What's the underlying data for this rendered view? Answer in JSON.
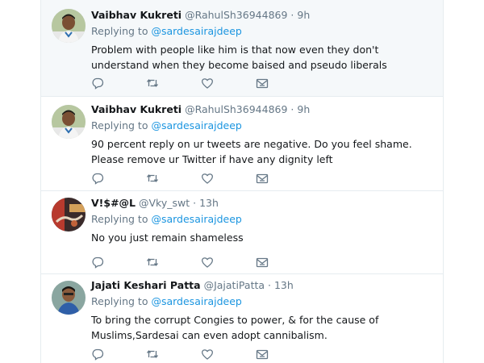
{
  "tweets": [
    {
      "name": "Vaibhav Kukreti",
      "handle": "@RahulSh36944869",
      "separator": "·",
      "time": "9h",
      "replying_label": "Replying to",
      "replying_to": "@sardesairajdeep",
      "text": "Problem with people like him is that now even they don't understand when they become baised and pseudo liberals",
      "icons": [
        "reply-icon",
        "retweet-icon",
        "like-icon",
        "message-icon"
      ]
    },
    {
      "name": "Vaibhav Kukreti",
      "handle": "@RahulSh36944869",
      "separator": "·",
      "time": "9h",
      "replying_label": "Replying to",
      "replying_to": "@sardesairajdeep",
      "text": "90 percent reply on ur tweets are negative. Do you feel shame. Please remove ur Twitter if have any dignity left",
      "icons": [
        "reply-icon",
        "retweet-icon",
        "like-icon",
        "message-icon"
      ]
    },
    {
      "name": "V!$#@L",
      "handle": "@Vky_swt",
      "separator": "·",
      "time": "13h",
      "replying_label": "Replying to",
      "replying_to": "@sardesairajdeep",
      "text": "No you just remain shameless",
      "icons": [
        "reply-icon",
        "retweet-icon",
        "like-icon",
        "message-icon"
      ]
    },
    {
      "name": "Jajati Keshari Patta",
      "handle": "@JajatiPatta",
      "separator": "·",
      "time": "13h",
      "replying_label": "Replying to",
      "replying_to": "@sardesairajdeep",
      "text": "To bring the corrupt Congies to power, & for the cause of Muslims,Sardesai can even adopt cannibalism.",
      "icons": [
        "reply-icon",
        "retweet-icon",
        "like-icon",
        "message-icon"
      ]
    }
  ],
  "colors": {
    "link": "#1b95e0",
    "muted": "#657786",
    "text": "#14171a",
    "highlight_bg": "#f5f8fa",
    "divider": "#e6ecf0"
  }
}
